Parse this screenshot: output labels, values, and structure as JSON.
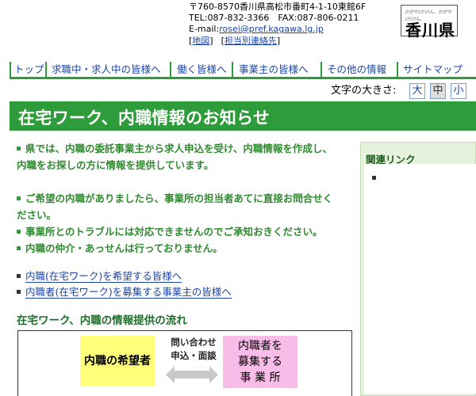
{
  "header": {
    "address": "〒760-8570香川県高松市番町4-1-10東館6F",
    "tel": "TEL:087-832-3366　FAX:087-806-0211",
    "email_label": "E-mail:",
    "email": "rosei@pref.kagawa.lg.jp",
    "links": [
      {
        "label": "地図"
      },
      {
        "label": "担当別連絡先"
      }
    ],
    "logo": {
      "small_text": "かがやけ!けん、かがやけ!けん。",
      "name": "香川県"
    }
  },
  "nav": {
    "items": [
      {
        "label": "トップ"
      },
      {
        "label": "求職中・求人中の皆様へ"
      },
      {
        "label": "働く皆様へ"
      },
      {
        "label": "事業主の皆様へ"
      },
      {
        "label": "その他の情報"
      },
      {
        "label": "サイトマップ"
      }
    ]
  },
  "text_size": {
    "label": "文字の大きさ:",
    "options": [
      {
        "label": "大",
        "active": false
      },
      {
        "label": "中",
        "active": true
      },
      {
        "label": "小",
        "active": false
      }
    ]
  },
  "page": {
    "title": "在宅ワーク、内職情報のお知らせ"
  },
  "notices": [
    {
      "line1": "県では、内職の委託事業主から求人申込を受け、内職情報を作成し、",
      "line2": "内職をお探しの方に情報を提供しています。"
    },
    {
      "line1": "ご希望の内職がありましたら、事業所の担当者あてに直接お問合せく",
      "line2": "ださい。"
    },
    {
      "line1": "事業所とのトラブルには対応できませんのでご承知おきください。"
    },
    {
      "line1": "内職の仲介・あっせんは行っておりません。"
    }
  ],
  "info_links": [
    {
      "label": "内職(在宅ワーク)を希望する皆様へ"
    },
    {
      "label": "内職者(在宅ワーク)を募集する事業主の皆様へ"
    }
  ],
  "flow": {
    "heading": "在宅ワーク、内職の情報提供の流れ",
    "left_box": "内職の希望者",
    "middle_line1": "問い合わせ",
    "middle_line2": "申込・面談",
    "right_box_lines": [
      "内職者を",
      "募集する",
      "事 業 所"
    ]
  },
  "sidebar": {
    "heading": "関連リンク"
  },
  "colors": {
    "accent_green": "#2e9c3a",
    "link_blue": "#1a44a8",
    "flow_yellow": "#ffff7a",
    "flow_pink": "#f8bce8",
    "sidebar_bg": "#e6f2dc"
  }
}
